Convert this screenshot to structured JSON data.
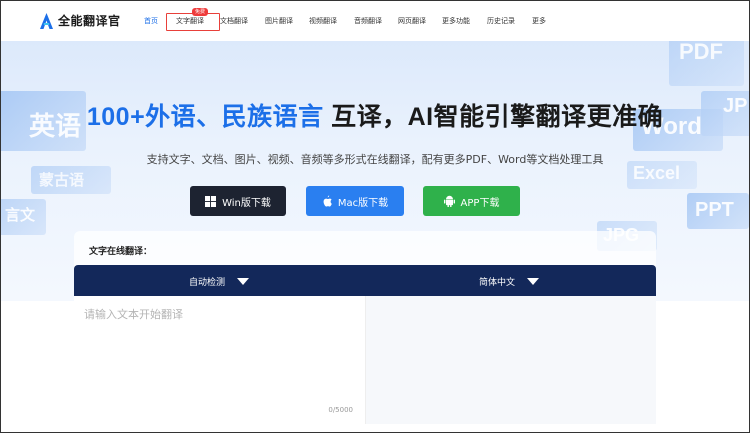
{
  "header": {
    "logo_text": "全能翻译官",
    "nav": [
      {
        "label": "首页",
        "active": true
      },
      {
        "label": "文字翻译",
        "active": false,
        "badge": "免费"
      },
      {
        "label": "文档翻译",
        "active": false
      },
      {
        "label": "图片翻译",
        "active": false
      },
      {
        "label": "视频翻译",
        "active": false
      },
      {
        "label": "音频翻译",
        "active": false
      },
      {
        "label": "网页翻译",
        "active": false
      },
      {
        "label": "更多功能",
        "active": false
      },
      {
        "label": "历史记录",
        "active": false
      },
      {
        "label": "更多",
        "active": false
      }
    ]
  },
  "hero": {
    "title_blue": "100+外语、民族语言",
    "title_dark": " 互译，AI智能引擎翻译更准确",
    "subtitle": "支持文字、文档、图片、视频、音频等多形式在线翻译，配有更多PDF、Word等文档处理工具",
    "buttons": {
      "win": "Win版下载",
      "mac": "Mac版下载",
      "app": "APP下载"
    },
    "deco": {
      "yingyu": "英语",
      "mengguyu": "蒙古语",
      "yanwen": "言文",
      "pdf": "PDF",
      "jp": "JP",
      "word": "Word",
      "excel": "Excel",
      "ppt": "PPT",
      "jpg": "JPG"
    }
  },
  "translator": {
    "label": "文字在线翻译：",
    "source_lang": "自动检测",
    "target_lang": "简体中文",
    "placeholder": "请输入文本开始翻译",
    "counter": "0/5000"
  },
  "colors": {
    "accent": "#1c6fe8",
    "lang_bar": "#13285a",
    "win_button": "#1d2331",
    "mac_button": "#2a7ff0",
    "app_button": "#2fb14b",
    "badge": "#ee3b3b"
  }
}
